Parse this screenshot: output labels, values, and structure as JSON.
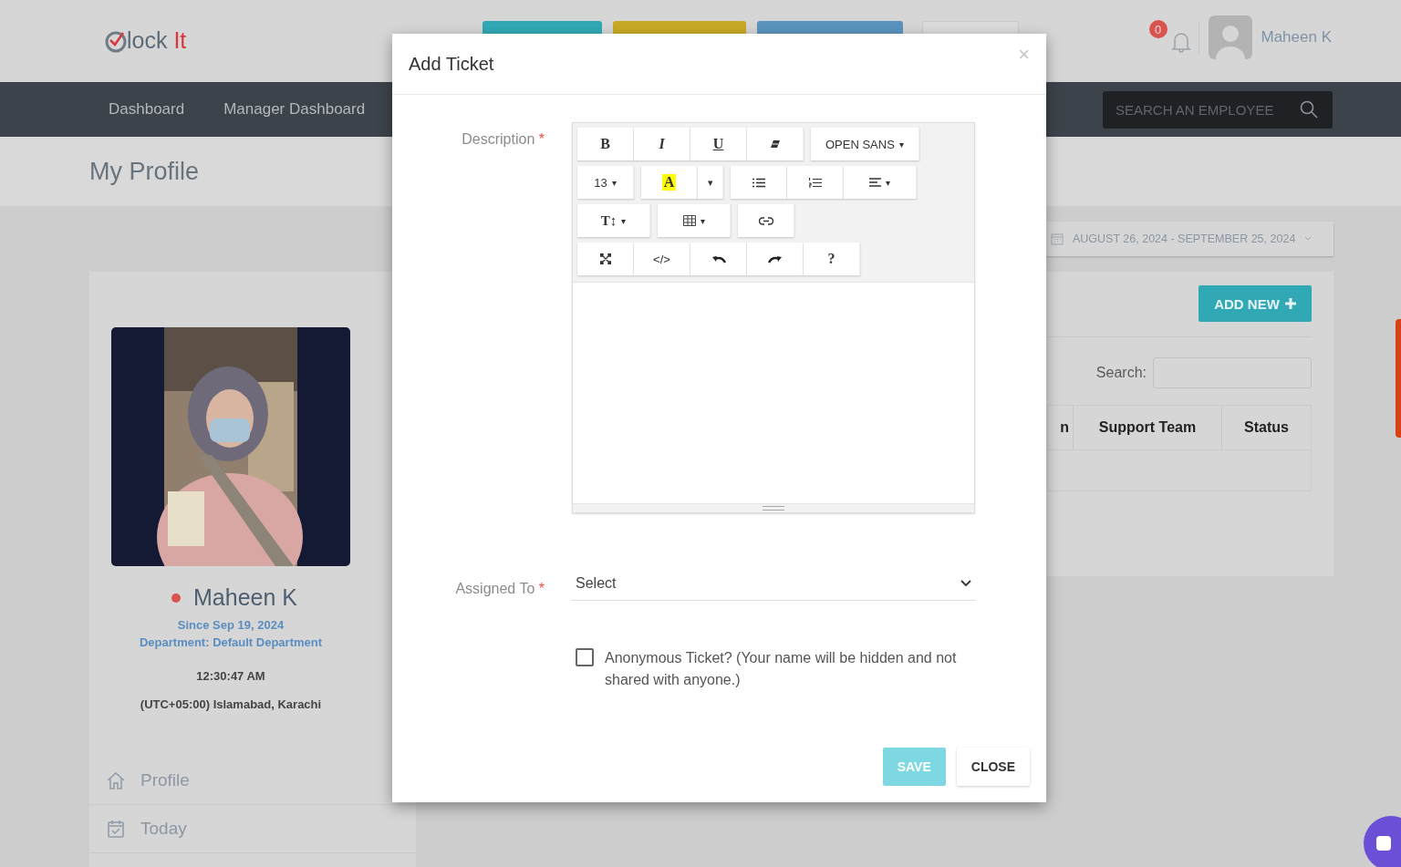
{
  "header": {
    "logo": {
      "text": "lock",
      "accent": "It"
    },
    "buttons": [
      {
        "color": "#31a9b5"
      },
      {
        "color": "#c9a925"
      },
      {
        "color": "#5a94bf"
      },
      {
        "color": "#dcdcdc"
      }
    ],
    "notifications": "0",
    "user": "Maheen K"
  },
  "nav": {
    "items": [
      "Dashboard",
      "Manager Dashboard"
    ],
    "search": {
      "placeholder": "SEARCH AN EMPLOYEE"
    }
  },
  "page_title": "My Profile",
  "profile": {
    "name": "Maheen K",
    "online": false,
    "since": "Since Sep 19, 2024",
    "department": "Department: Default Department",
    "time": "12:30:47 AM",
    "timezone": "(UTC+05:00) Islamabad, Karachi",
    "menu": [
      {
        "label": "Profile",
        "kind": "home"
      },
      {
        "label": "Today",
        "kind": "calendar"
      }
    ]
  },
  "tickets": {
    "date_range": "AUGUST 26, 2024 - SEPTEMBER 25, 2024",
    "add_button": "ADD NEW",
    "search_label": "Search:",
    "columns": [
      "n",
      "Support Team",
      "Status"
    ]
  },
  "modal": {
    "title": "Add Ticket",
    "close": "×",
    "description_label": "Description",
    "required": "*",
    "toolbar": [
      [
        [
          {
            "kind": "bold",
            "label": "B"
          },
          {
            "kind": "italic",
            "label": "I"
          },
          {
            "kind": "underline",
            "label": "U"
          },
          {
            "kind": "eraser"
          }
        ],
        [
          {
            "kind": "plain",
            "label": "OPEN SANS",
            "caret": "▾"
          }
        ]
      ],
      [
        [
          {
            "kind": "plain",
            "label": "13",
            "caret": "▾"
          }
        ],
        [
          {
            "kind": "highlight",
            "label": "A"
          },
          {
            "kind": "caret",
            "label": "▾"
          }
        ],
        [
          {
            "kind": "ul"
          },
          {
            "kind": "ol"
          },
          {
            "kind": "align",
            "caret": "▾"
          }
        ]
      ],
      [
        [
          {
            "kind": "serif",
            "label": "T↕",
            "caret": "▾"
          }
        ],
        [
          {
            "kind": "table",
            "caret": "▾"
          }
        ],
        [
          {
            "kind": "link"
          }
        ]
      ],
      [
        [
          {
            "kind": "fullscreen"
          },
          {
            "kind": "plain",
            "label": "</>"
          },
          {
            "kind": "undo"
          },
          {
            "kind": "redo"
          },
          {
            "kind": "bold",
            "label": "?"
          }
        ]
      ]
    ],
    "assigned_label": "Assigned To",
    "select": {
      "value": "Select"
    },
    "anonymous": {
      "label": "Anonymous Ticket? (Your name will be hidden and not shared with anyone.)",
      "checked": false
    },
    "buttons": [
      {
        "label": "SAVE",
        "kind": "primary",
        "disabled": true
      },
      {
        "label": "CLOSE",
        "kind": "default",
        "disabled": false
      }
    ]
  }
}
